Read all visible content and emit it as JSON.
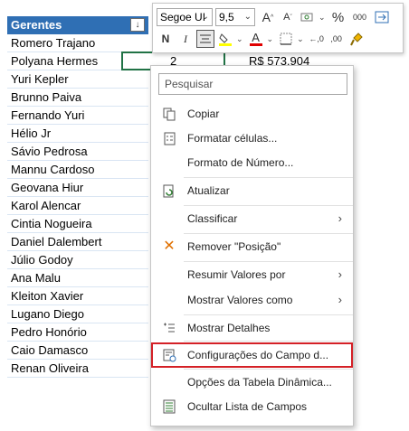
{
  "sheet": {
    "header": "Gerentes",
    "filter_icon": "sort-filter-icon",
    "names": [
      "Romero Trajano",
      "Polyana Hermes",
      "Yuri Kepler",
      "Brunno Paiva",
      "Fernando Yuri",
      "Hélio Jr",
      "Sávio Pedrosa",
      "Mannu Cardoso",
      "Geovana Hiur",
      "Karol Alencar",
      "Cintia Nogueira",
      "Daniel Dalembert",
      "Júlio Godoy",
      "Ana Malu",
      "Kleiton Xavier",
      "Lugano Diego",
      "Pedro Honório",
      "Caio Damasco",
      "Renan Oliveira"
    ],
    "selected_value": "2",
    "money_value": "R$ 573.904"
  },
  "mini_toolbar": {
    "font_name": "Segoe UI",
    "font_size": "9,5",
    "increase_font": "A",
    "decrease_font": "A",
    "bold": "N",
    "italic": "I",
    "percent": "%",
    "thousands": "000",
    "font_color_letter": "A",
    "fill_color": "#ffff00",
    "font_color": "#e00000"
  },
  "menu": {
    "search_placeholder": "Pesquisar",
    "items": {
      "copy": "Copiar",
      "format_cells": "Formatar células...",
      "number_format": "Formato de Número...",
      "refresh": "Atualizar",
      "sort": "Classificar",
      "remove": "Remover \"Posição\"",
      "summarize": "Resumir Valores por",
      "show_values": "Mostrar Valores como",
      "show_details": "Mostrar Detalhes",
      "field_settings": "Configurações do Campo d...",
      "pivot_options": "Opções da Tabela Dinâmica...",
      "hide_field_list": "Ocultar Lista de Campos"
    },
    "highlight_color": "#d42026"
  }
}
